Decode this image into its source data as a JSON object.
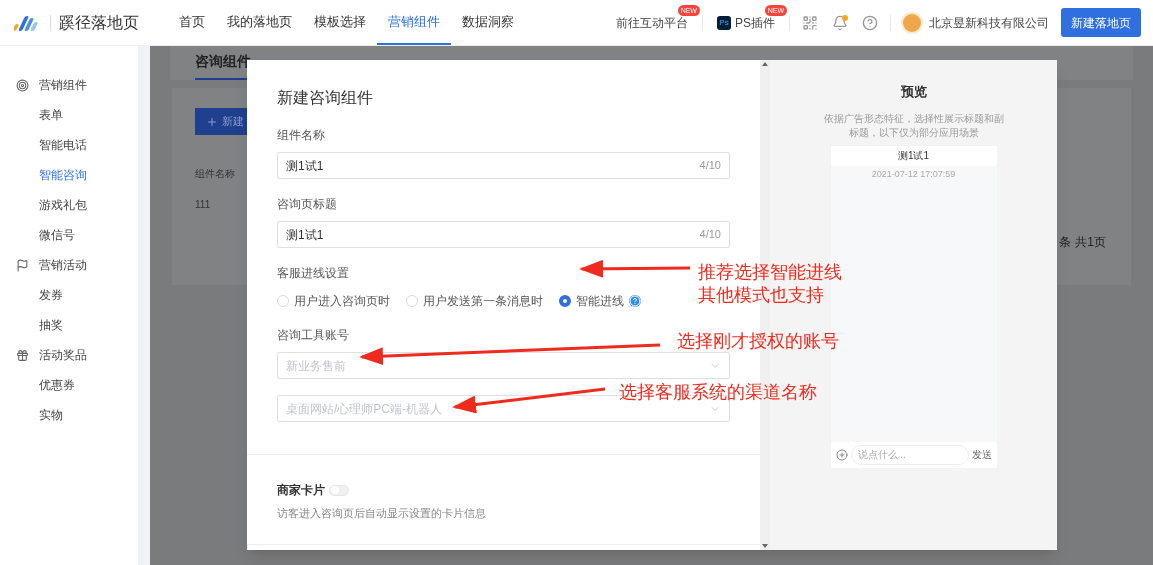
{
  "app": {
    "name": "蹊径落地页"
  },
  "nav": [
    {
      "label": "首页",
      "selected": false
    },
    {
      "label": "我的落地页",
      "selected": false
    },
    {
      "label": "模板选择",
      "selected": false
    },
    {
      "label": "营销组件",
      "selected": true
    },
    {
      "label": "数据洞察",
      "selected": false
    }
  ],
  "header_links": [
    {
      "label": "前往互动平台",
      "badge": "NEW",
      "kind": "plain"
    },
    {
      "label": "PS插件",
      "badge": "NEW",
      "kind": "ps",
      "logo_text": "Ps"
    }
  ],
  "account": {
    "name": "北京昱新科技有限公司"
  },
  "primary_button": "新建落地页",
  "sidebar": [
    {
      "label": "营销组件",
      "kind": "target",
      "children": [
        {
          "label": "表单",
          "selected": false
        },
        {
          "label": "智能电话",
          "selected": false
        },
        {
          "label": "智能咨询",
          "selected": true
        },
        {
          "label": "游戏礼包",
          "selected": false
        },
        {
          "label": "微信号",
          "selected": false
        }
      ]
    },
    {
      "label": "营销活动",
      "kind": "flag",
      "children": [
        {
          "label": "发券",
          "selected": false
        },
        {
          "label": "抽奖",
          "selected": false
        }
      ]
    },
    {
      "label": "活动奖品",
      "kind": "gift",
      "children": [
        {
          "label": "优惠券",
          "selected": false
        },
        {
          "label": "实物",
          "selected": false
        }
      ]
    }
  ],
  "background_page": {
    "tab": "咨询组件",
    "button": "新建",
    "column": "组件名称",
    "row": "111",
    "pagination": [
      "条",
      "共1页"
    ]
  },
  "modal": {
    "title": "新建咨询组件",
    "name_field": {
      "label": "组件名称",
      "value": "测1试1",
      "counter": "4/10"
    },
    "page_title_field": {
      "label": "咨询页标题",
      "value": "测1试1",
      "counter": "4/10"
    },
    "routing": {
      "label": "客服进线设置",
      "options": [
        {
          "label": "用户进入咨询页时",
          "selected": false,
          "help": false
        },
        {
          "label": "用户发送第一条消息时",
          "selected": false,
          "help": false
        },
        {
          "label": "智能进线",
          "selected": true,
          "help": true
        }
      ]
    },
    "account_field": {
      "label": "咨询工具账号",
      "placeholder": "新业务售前"
    },
    "channel_field": {
      "placeholder": "桌面网站/心理师PC端-机器人"
    },
    "merchant_card": {
      "label": "商家卡片",
      "on": false,
      "description": "访客进入咨询页后自动显示设置的卡片信息"
    }
  },
  "preview": {
    "title": "预览",
    "description": "依据广告形态特征，选择性展示标题和副标题，以下仅为部分应用场景",
    "chat_title": "测1试1",
    "timestamp": "2021-07-12 17:07:59",
    "input_placeholder": "说点什么...",
    "send": "发送"
  },
  "annotations": [
    {
      "lines": [
        "推荐选择智能进线",
        "其他模式也支持"
      ]
    },
    {
      "lines": [
        "选择刚才授权的账号"
      ]
    },
    {
      "lines": [
        "选择客服系统的渠道名称"
      ]
    }
  ]
}
